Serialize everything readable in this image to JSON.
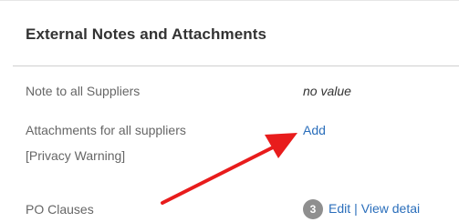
{
  "section": {
    "title": "External Notes and Attachments"
  },
  "rows": {
    "note": {
      "label": "Note to all Suppliers",
      "value": "no value"
    },
    "attachments": {
      "label_line1": "Attachments for all suppliers",
      "label_line2": "[Privacy Warning]",
      "action": "Add"
    },
    "po_clauses": {
      "label": "PO Clauses",
      "count": "3",
      "edit": "Edit",
      "separator": "|",
      "view": "View detai"
    }
  },
  "annotation": {
    "arrow_color": "#e81c1c"
  },
  "colors": {
    "link": "#2a6ebb",
    "label": "#666666",
    "badge": "#8f8f8f"
  }
}
